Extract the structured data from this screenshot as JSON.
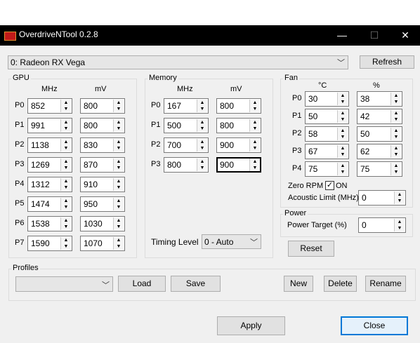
{
  "window": {
    "title": "OverdriveNTool 0.2.8",
    "minimize_icon": "minimize-icon",
    "maximize_icon": "maximize-icon",
    "close_icon": "close-icon"
  },
  "device": {
    "selected": "0: Radeon RX Vega",
    "refresh_label": "Refresh"
  },
  "gpu": {
    "title": "GPU",
    "col_mhz": "MHz",
    "col_mv": "mV",
    "states": [
      {
        "label": "P0",
        "mhz": "852",
        "mv": "800"
      },
      {
        "label": "P1",
        "mhz": "991",
        "mv": "800"
      },
      {
        "label": "P2",
        "mhz": "1138",
        "mv": "830"
      },
      {
        "label": "P3",
        "mhz": "1269",
        "mv": "870"
      },
      {
        "label": "P4",
        "mhz": "1312",
        "mv": "910"
      },
      {
        "label": "P5",
        "mhz": "1474",
        "mv": "950"
      },
      {
        "label": "P6",
        "mhz": "1538",
        "mv": "1030"
      },
      {
        "label": "P7",
        "mhz": "1590",
        "mv": "1070"
      }
    ]
  },
  "memory": {
    "title": "Memory",
    "col_mhz": "MHz",
    "col_mv": "mV",
    "states": [
      {
        "label": "P0",
        "mhz": "167",
        "mv": "800"
      },
      {
        "label": "P1",
        "mhz": "500",
        "mv": "800"
      },
      {
        "label": "P2",
        "mhz": "700",
        "mv": "900"
      },
      {
        "label": "P3",
        "mhz": "800",
        "mv": "900"
      }
    ],
    "timing_label": "Timing Level",
    "timing_value": "0 - Auto"
  },
  "fan": {
    "title": "Fan",
    "col_temp": "°C",
    "col_pct": "%",
    "states": [
      {
        "label": "P0",
        "temp": "30",
        "pct": "38"
      },
      {
        "label": "P1",
        "temp": "50",
        "pct": "42"
      },
      {
        "label": "P2",
        "temp": "58",
        "pct": "50"
      },
      {
        "label": "P3",
        "temp": "67",
        "pct": "62"
      },
      {
        "label": "P4",
        "temp": "75",
        "pct": "75"
      }
    ],
    "zero_rpm_label": "Zero RPM",
    "zero_rpm_check": "✓",
    "zero_rpm_state": "ON",
    "acoustic_label": "Acoustic Limit (MHz)",
    "acoustic_value": "0"
  },
  "power": {
    "title": "Power",
    "target_label": "Power Target (%)",
    "target_value": "0",
    "reset_label": "Reset"
  },
  "profiles": {
    "title": "Profiles",
    "selected": "",
    "load_label": "Load",
    "save_label": "Save",
    "new_label": "New",
    "delete_label": "Delete",
    "rename_label": "Rename"
  },
  "footer": {
    "apply_label": "Apply",
    "close_label": "Close"
  },
  "spin_up": "▲",
  "spin_down": "▼",
  "combo_arrow": "﹀"
}
